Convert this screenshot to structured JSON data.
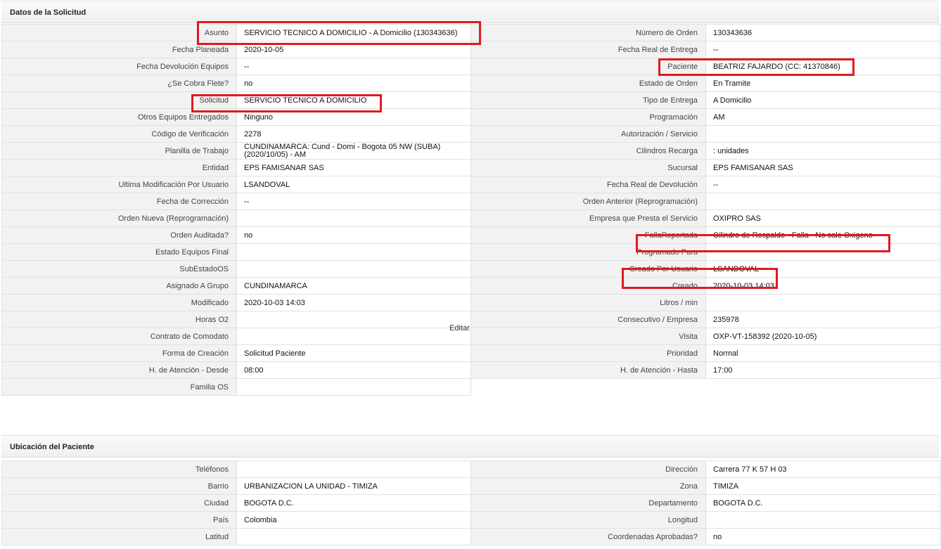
{
  "sections": {
    "request_title": "Datos de la Solicitud",
    "location_title": "Ubicación del Paciente"
  },
  "request_left": [
    {
      "label": "Asunto",
      "value": "SERVICIO TECNICO A DOMICILIO - A Domicilio (130343636)"
    },
    {
      "label": "Fecha Planeada",
      "value": "2020-10-05"
    },
    {
      "label": "Fecha Devolución Equipos",
      "value": "--"
    },
    {
      "label": "¿Se Cobra Flete?",
      "value": "no"
    },
    {
      "label": "Solicitud",
      "value": "SERVICIO TECNICO A DOMICILIO"
    },
    {
      "label": "Otros Equipos Entregados",
      "value": "Ninguno"
    },
    {
      "label": "Código de Verificación",
      "value": "2278"
    },
    {
      "label": "Planilla de Trabajo",
      "value": "CUNDINAMARCA: Cund - Domi - Bogota 05 NW (SUBA) (2020/10/05) - AM"
    },
    {
      "label": "Entidad",
      "value": "EPS FAMISANAR SAS"
    },
    {
      "label": "Ultima Modificación Por Usuario",
      "value": "LSANDOVAL"
    },
    {
      "label": "Fecha de Corrección",
      "value": "--"
    },
    {
      "label": "Orden Nueva (Reprogramación)",
      "value": ""
    },
    {
      "label": "Orden Auditada?",
      "value": "no"
    },
    {
      "label": "Estado Equipos Final",
      "value": ""
    },
    {
      "label": "SubEstadoOS",
      "value": ""
    },
    {
      "label": "Asignado A Grupo",
      "value": "CUNDINAMARCA"
    },
    {
      "label": "Modificado",
      "value": "2020-10-03 14:03"
    },
    {
      "label": "Horas O2",
      "value": ""
    },
    {
      "label": "Contrato de Comodato",
      "value": ""
    },
    {
      "label": "Forma de Creación",
      "value": "Solicitud Paciente"
    },
    {
      "label": "H. de Atención - Desde",
      "value": "08:00"
    },
    {
      "label": "Familia OS",
      "value": ""
    }
  ],
  "request_right": [
    {
      "label": "Número de Orden",
      "value": "130343636"
    },
    {
      "label": "Fecha Real de Entrega",
      "value": "--"
    },
    {
      "label": "Paciente",
      "value": "BEATRIZ FAJARDO (CC: 41370846)"
    },
    {
      "label": "Estado de Orden",
      "value": "En Tramite"
    },
    {
      "label": "Tipo de Entrega",
      "value": "A Domicilio"
    },
    {
      "label": "Programación",
      "value": "AM"
    },
    {
      "label": "Autorización / Servicio",
      "value": ""
    },
    {
      "label": "Cilindros Recarga",
      "value": ": unidades"
    },
    {
      "label": "Sucursal",
      "value": "EPS FAMISANAR SAS"
    },
    {
      "label": "Fecha Real de Devolución",
      "value": "--"
    },
    {
      "label": "Orden Anterior (Reprogramación)",
      "value": ""
    },
    {
      "label": "Empresa que Presta el Servicio",
      "value": "OXIPRO SAS"
    },
    {
      "label": "FallaReportada",
      "value": "Cilindro de Respaldo - Falla - No sale Oxigeno"
    },
    {
      "label": "Programado Para",
      "value": ""
    },
    {
      "label": "Creado Por Usuario",
      "value": "LSANDOVAL"
    },
    {
      "label": "Creado",
      "value": "2020-10-03 14:03"
    },
    {
      "label": "Litros / min",
      "value": ""
    },
    {
      "label": "Consecutivo / Empresa",
      "value": "235978"
    },
    {
      "label": "Visita",
      "value": "OXP-VT-158392 (2020-10-05)"
    },
    {
      "label": "Prioridad",
      "value": "Normal"
    },
    {
      "label": "H. de Atención - Hasta",
      "value": "17:00"
    }
  ],
  "edit_label": "Editar",
  "location_left": [
    {
      "label": "Teléfonos",
      "value": ""
    },
    {
      "label": "Barrio",
      "value": "URBANIZACION LA UNIDAD - TIMIZA"
    },
    {
      "label": "Ciudad",
      "value": "BOGOTA D.C."
    },
    {
      "label": "País",
      "value": "Colombia"
    },
    {
      "label": "Latitud",
      "value": ""
    }
  ],
  "location_right": [
    {
      "label": "Dirección",
      "value": "Carrera 77 K 57 H 03"
    },
    {
      "label": "Zona",
      "value": "TIMIZA"
    },
    {
      "label": "Departamento",
      "value": "BOGOTA D.C."
    },
    {
      "label": "Longitud",
      "value": ""
    },
    {
      "label": "Coordenadas Aprobadas?",
      "value": "no"
    }
  ],
  "highlight_color": "#e0191f"
}
